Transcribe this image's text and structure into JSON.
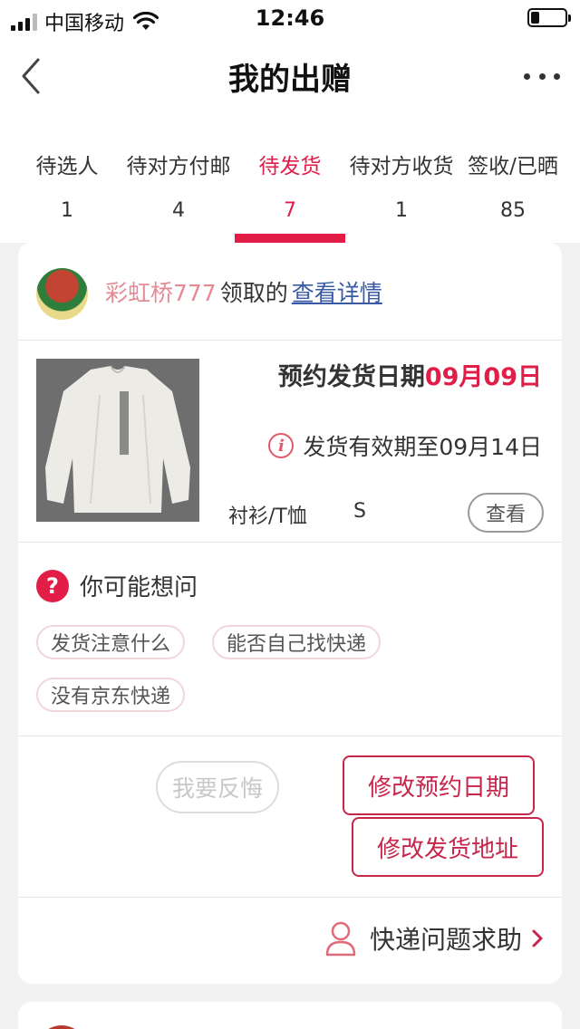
{
  "status_bar": {
    "carrier": "中国移动",
    "time": "12:46",
    "icons": [
      "signal-icon",
      "wifi-icon",
      "battery-icon"
    ]
  },
  "nav": {
    "title": "我的出赠",
    "back_icon": "chevron-left-icon",
    "more_icon": "more-icon"
  },
  "tabs": [
    {
      "label": "待选人",
      "count": "1",
      "active": false
    },
    {
      "label": "待对方付邮",
      "count": "4",
      "active": false
    },
    {
      "label": "待发货",
      "count": "7",
      "active": true
    },
    {
      "label": "待对方收货",
      "count": "1",
      "active": false
    },
    {
      "label": "签收/已晒",
      "count": "85",
      "active": false
    }
  ],
  "card": {
    "username": "彩虹桥777",
    "collected_text": "领取的",
    "details_link": "查看详情",
    "schedule_label": "预约发货日期",
    "schedule_date": "09月09日",
    "validity_text": "发货有效期至09月14日",
    "category": "衬衫/T恤",
    "size": "S",
    "view_button": "查看",
    "faq_title": "你可能想问",
    "faq_chips": [
      "发货注意什么",
      "能否自己找快递",
      "没有京东快递"
    ],
    "regret_button": "我要反悔",
    "change_date_button": "修改预约日期",
    "change_address_button": "修改发货地址",
    "help_text": "快递问题求助"
  },
  "colors": {
    "accent": "#e11d48",
    "button_border": "#c8254a",
    "link": "#3b5aa6",
    "username": "#e58a94"
  }
}
